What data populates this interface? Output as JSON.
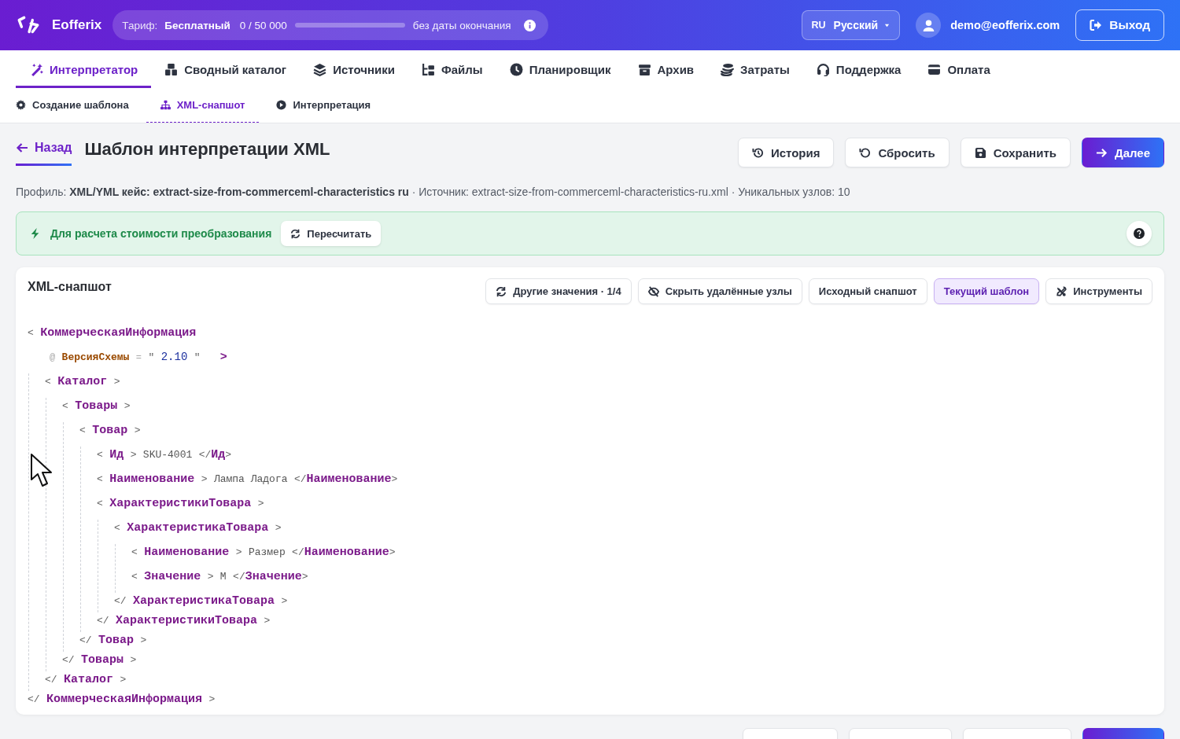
{
  "header": {
    "brand": "Eofferix",
    "plan": {
      "label": "Тариф:",
      "name": "Бесплатный",
      "usage": "0 / 50 000",
      "level": 0,
      "expiry": "без даты окончания"
    },
    "language": {
      "code": "RU",
      "name": "Русский"
    },
    "user": "demo@eofferix.com",
    "logout": "Выход"
  },
  "nav": [
    {
      "label": "Интерпретатор",
      "kind": "wand",
      "selected": true
    },
    {
      "label": "Сводный каталог",
      "kind": "boxes",
      "selected": false
    },
    {
      "label": "Источники",
      "kind": "layers",
      "selected": false
    },
    {
      "label": "Файлы",
      "kind": "files",
      "selected": false
    },
    {
      "label": "Планировщик",
      "kind": "clock",
      "selected": false
    },
    {
      "label": "Архив",
      "kind": "archive",
      "selected": false
    },
    {
      "label": "Затраты",
      "kind": "coins",
      "selected": false
    },
    {
      "label": "Поддержка",
      "kind": "headset",
      "selected": false
    },
    {
      "label": "Оплата",
      "kind": "card",
      "selected": false
    }
  ],
  "subnav": [
    {
      "label": "Создание шаблона",
      "kind": "gear",
      "selected": false
    },
    {
      "label": "XML-снапшот",
      "kind": "sitemap",
      "selected": true
    },
    {
      "label": "Интерпретация",
      "kind": "play",
      "selected": false
    }
  ],
  "page": {
    "back": "Назад",
    "title": "Шаблон интерпретации XML",
    "actions": [
      {
        "label": "История",
        "kind": "history",
        "primary": false
      },
      {
        "label": "Сбросить",
        "kind": "undo",
        "primary": false
      },
      {
        "label": "Сохранить",
        "kind": "save",
        "primary": false
      },
      {
        "label": "Далее",
        "kind": "next",
        "primary": true
      }
    ],
    "info": "Профиль: **XML/YML кейс: extract-size-from-commerceml-characteristics ru** · Источник: extract-size-from-commerceml-characteristics-ru.xml · Уникальных узлов: 10"
  },
  "notice": {
    "text": "Для расчета стоимости преобразования",
    "button": "Пересчитать"
  },
  "snapshot": {
    "title": "XML-снапшот",
    "tools": [
      {
        "label": "Другие значения · 1/4",
        "kind": "cycle",
        "selected": false
      },
      {
        "label": "Скрыть удалённые узлы",
        "kind": "eye-off",
        "selected": false
      },
      {
        "label": "Исходный снапшот",
        "kind": "plain",
        "selected": false
      },
      {
        "label": "Текущий шаблон",
        "kind": "plain",
        "selected": true
      },
      {
        "label": "Инструменты",
        "kind": "tools",
        "selected": false
      }
    ],
    "syntax": {
      "open": "<",
      "close": ">",
      "end": "</",
      "attr": "@",
      "eq": "=",
      "quote": "\""
    },
    "tree": {
      "tag": "КоммерческаяИнформация",
      "end_tag": "КоммерческаяИнформация",
      "attributes": [
        {
          "name": "ВерсияСхемы",
          "value": "2.10"
        }
      ],
      "children": [
        {
          "tag": "Каталог",
          "end_tag": "Каталог",
          "children": [
            {
              "tag": "Товары",
              "end_tag": "Товары",
              "children": [
                {
                  "tag": "Товар",
                  "end_tag": "Товар",
                  "children": [
                    {
                      "tag": "Ид",
                      "text": "SKU-4001",
                      "end_tag": "Ид"
                    },
                    {
                      "tag": "Наименование",
                      "text": "Лампа Ладога",
                      "end_tag": "Наименование"
                    },
                    {
                      "tag": "ХарактеристикиТовара",
                      "end_tag": "ХарактеристикиТовара",
                      "children": [
                        {
                          "tag": "ХарактеристикаТовара",
                          "end_tag": "ХарактеристикаТовара",
                          "children": [
                            {
                              "tag": "Наименование",
                              "text": "Размер",
                              "end_tag": "Наименование"
                            },
                            {
                              "tag": "Значение",
                              "text": "M",
                              "end_tag": "Значение"
                            }
                          ]
                        }
                      ]
                    }
                  ]
                }
              ]
            }
          ]
        }
      ]
    }
  },
  "bottom_actions": [
    {
      "primary": false
    },
    {
      "primary": false
    },
    {
      "primary": false
    },
    {
      "primary": true
    }
  ]
}
